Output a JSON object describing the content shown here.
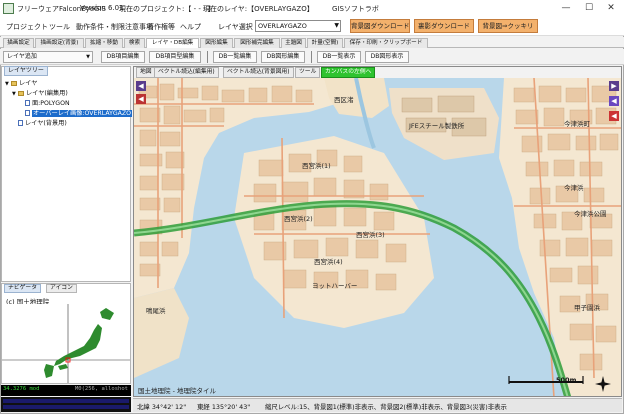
{
  "window": {
    "app_title": "フリーウェアFalconEyeGIS",
    "version": "Version 6.01",
    "project": "現在のプロジェクト:【 - - - 】",
    "current_layer": "現在のレイヤ:【OVERLAYGAZO】",
    "gis_title": "GISソフトラボ",
    "minimize_label": "—",
    "maximize_label": "☐",
    "close_label": "✕"
  },
  "menu": {
    "items": [
      "プロジェクト",
      "ツール",
      "動作条件・制限注意事項",
      "著作権等",
      "ヘルプ"
    ],
    "layer_select_label": "レイヤ選択",
    "layer_select_value": "OVERLAYGAZO",
    "buttons": [
      "背景図ダウンロード",
      "裏影ダウンロード",
      "背景図⇒クッキリ"
    ]
  },
  "tabs": [
    "描画設定",
    "描画設定(背景)",
    "拡縮・移動",
    "検索",
    "レイヤ・DB編集",
    "図形編集",
    "図形補完編集",
    "主題図",
    "計量(空間)",
    "保存・印刷・クリップボード"
  ],
  "toolbar": {
    "items": [
      "レイヤ追加",
      "DB項目編集",
      "DB項目型編集",
      "DB一覧編集",
      "DB図形編集",
      "DB一覧表示",
      "DB図形表示"
    ]
  },
  "left_panel": {
    "tab": "レイヤツリー",
    "tree": [
      {
        "label": "レイヤ",
        "level": 0
      },
      {
        "label": "レイヤ(編集用)",
        "level": 1
      },
      {
        "label": "面:POLYGON",
        "level": 2
      },
      {
        "label": "オーバーレイ画像:OVERLAYGAZO",
        "level": 2,
        "selected": true
      },
      {
        "label": "レイヤ(背景用)",
        "level": 1
      }
    ]
  },
  "nav_panel": {
    "tabs": [
      "ナビゲータ",
      "アイコン"
    ],
    "label": "(c) 国土地理院",
    "status_left": "34.3276 mod",
    "status_right": "M0(256, alloshot"
  },
  "map": {
    "tabs": [
      "地図",
      "ベクトル読込(編集用)",
      "ベクトル読込(背景図用)",
      "ツール",
      "カンバスの左側へ"
    ],
    "labels": [
      {
        "text": "西区渚"
      },
      {
        "text": "JFEスチール製鉄所"
      },
      {
        "text": "今津浜町"
      },
      {
        "text": "西宮浜(1)"
      },
      {
        "text": "西宮浜(2)"
      },
      {
        "text": "西宮浜(3)"
      },
      {
        "text": "西宮浜(4)"
      },
      {
        "text": "今津浜"
      },
      {
        "text": "ヨットハーバー"
      },
      {
        "text": "今津浜公園"
      },
      {
        "text": "鳴尾浜"
      },
      {
        "text": "甲子園浜"
      }
    ],
    "attribution": "国土地理院 - 地理院タイル",
    "scale_label": "500m",
    "colors": {
      "sea": "#b9d7ea",
      "land": "#f4e7d1",
      "road": "#e8a27a",
      "route": "#4caf50"
    }
  },
  "status": {
    "lat": "北緯  34°42' 12\"",
    "lon": "東経  135°20' 43\"",
    "info": "縮尺レベル:15、背景図1(標準)非表示、背景図2(標準)非表示、背景図3(災害)非表示"
  }
}
